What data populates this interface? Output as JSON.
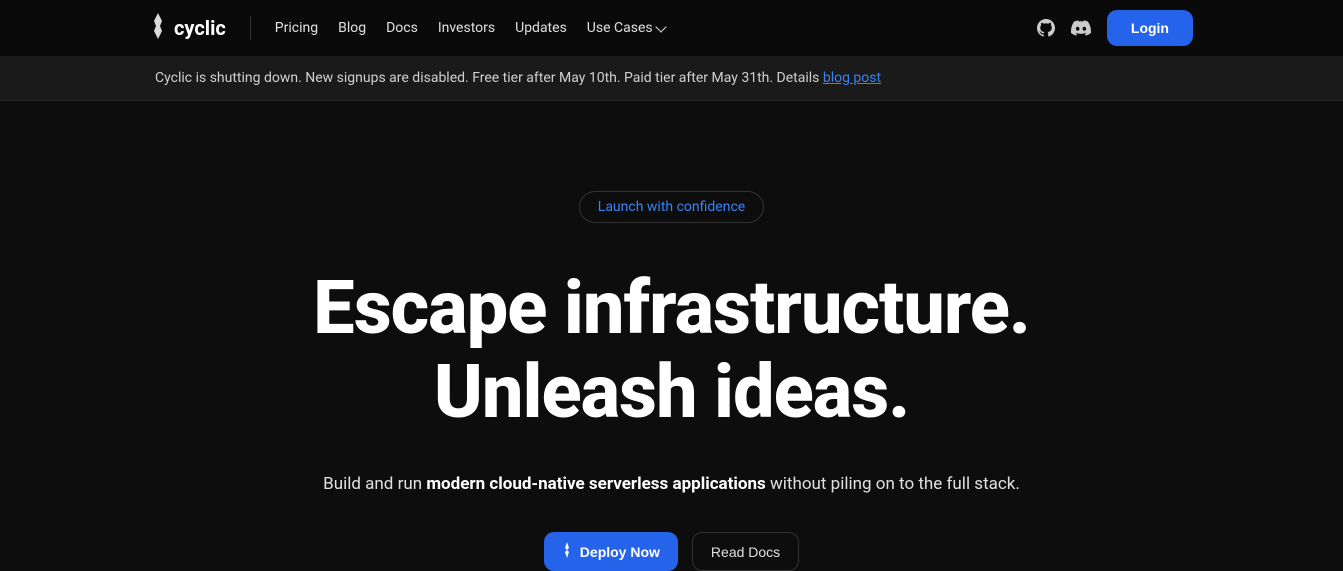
{
  "brand": {
    "name": "cyclic"
  },
  "nav": {
    "items": [
      "Pricing",
      "Blog",
      "Docs",
      "Investors",
      "Updates",
      "Use Cases"
    ]
  },
  "header": {
    "login_label": "Login"
  },
  "banner": {
    "text": "Cyclic is shutting down. New signups are disabled. Free tier after May 10th. Paid tier after May 31th. Details ",
    "link_text": "blog post"
  },
  "hero": {
    "badge": "Launch with confidence",
    "title_line1": "Escape infrastructure.",
    "title_line2": "Unleash ideas.",
    "subtitle_prefix": "Build and run ",
    "subtitle_bold": "modern cloud-native serverless applications",
    "subtitle_suffix": " without piling on to the full stack.",
    "deploy_label": "Deploy Now",
    "docs_label": "Read Docs"
  }
}
